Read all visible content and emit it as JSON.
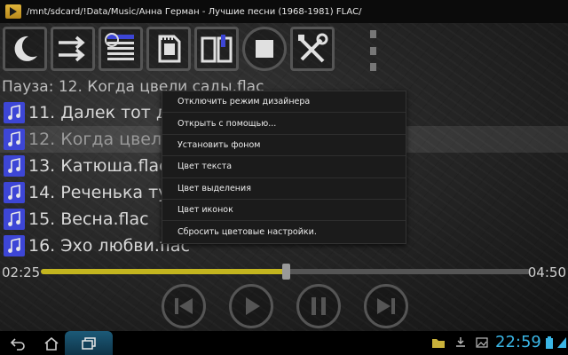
{
  "path_bar": {
    "text": "/mnt/sdcard/!Data/Music/Анна Герман - Лучшие песни (1968-1981) FLAC/"
  },
  "toolbar": {
    "buttons": [
      {
        "name": "night-mode-button",
        "icon": "moon-icon"
      },
      {
        "name": "shuffle-button",
        "icon": "arrows-icon"
      },
      {
        "name": "playlist-button",
        "icon": "list-icon"
      },
      {
        "name": "sdcard-button",
        "icon": "sdcard-icon"
      },
      {
        "name": "bookmarks-button",
        "icon": "book-icon"
      },
      {
        "name": "stop-button",
        "icon": "stop-icon"
      },
      {
        "name": "settings-button",
        "icon": "tools-icon"
      }
    ]
  },
  "status": {
    "text": "Пауза: 12. Когда цвели сады.flac"
  },
  "tracks": [
    {
      "title": "11. Далек тот день"
    },
    {
      "title": "12. Когда цвели сады.flac"
    },
    {
      "title": "13. Катюша.flac"
    },
    {
      "title": "14. Реченька тучная.flac"
    },
    {
      "title": "15. Весна.flac"
    },
    {
      "title": "16. Эхо любви.flac"
    }
  ],
  "current_track_index": 1,
  "progress": {
    "elapsed": "02:25",
    "total": "04:50",
    "fraction": 0.5
  },
  "context_menu": {
    "items": [
      "Отключить режим дизайнера",
      "Открыть с помощью...",
      "Установить фоном",
      "Цвет текста",
      "Цвет выделения",
      "Цвет иконок",
      "Сбросить цветовые настройки."
    ]
  },
  "system_bar": {
    "clock": "22:59"
  },
  "colors": {
    "accent": "#c3b51f",
    "note_icon": "#3d46d6",
    "clock": "#3ab6e6"
  }
}
